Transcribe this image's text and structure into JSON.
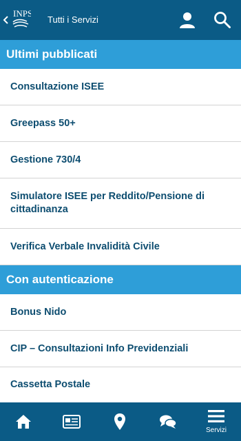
{
  "header": {
    "title": "Tutti i Servizi",
    "logo_text": "INPS"
  },
  "sections": [
    {
      "title": "Ultimi pubblicati",
      "items": [
        "Consultazione ISEE",
        "Greepass 50+",
        "Gestione 730/4",
        "Simulatore ISEE per Reddito/Pensione di cittadinanza",
        "Verifica Verbale Invalidità Civile"
      ]
    },
    {
      "title": "Con autenticazione",
      "items": [
        "Bonus Nido",
        "CIP – Consultazioni Info Previdenziali",
        "Cassetta Postale"
      ]
    }
  ],
  "bottom_nav": {
    "tabs": [
      {
        "icon": "home-icon"
      },
      {
        "icon": "newspaper-icon"
      },
      {
        "icon": "map-pin-icon"
      },
      {
        "icon": "chat-bubbles-icon"
      },
      {
        "icon": "menu-icon",
        "label": "Servizi"
      }
    ]
  },
  "colors": {
    "header": "#0b5b86",
    "section": "#2e9ed8",
    "item_text": "#0d4d70"
  }
}
